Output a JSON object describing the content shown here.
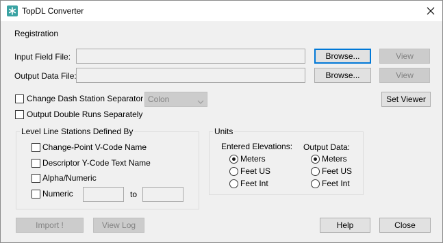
{
  "window": {
    "title": "TopDL Converter"
  },
  "registration": {
    "heading": "Registration",
    "input_field_label": "Input Field File:",
    "output_data_label": "Output Data File:",
    "input_field_value": "",
    "output_data_value": "",
    "browse_label": "Browse...",
    "view_label": "View"
  },
  "options": {
    "change_dash_label": "Change Dash Station Separator to:",
    "separator_value": "Colon",
    "output_double_runs_label": "Output Double Runs Separately",
    "set_viewer_label": "Set Viewer"
  },
  "level_line": {
    "title": "Level Line Stations Defined By",
    "change_point_label": "Change-Point V-Code Name",
    "descriptor_label": "Descriptor Y-Code Text Name",
    "alpha_numeric_label": "Alpha/Numeric",
    "numeric_label": "Numeric",
    "to_label": "to",
    "numeric_from": "",
    "numeric_to": ""
  },
  "units": {
    "title": "Units",
    "entered_elevations_label": "Entered Elevations:",
    "output_data_label": "Output Data:",
    "meters": "Meters",
    "feet_us": "Feet US",
    "feet_int": "Feet Int",
    "entered_selected": "Meters",
    "output_selected": "Meters"
  },
  "footer": {
    "import_label": "Import !",
    "view_log_label": "View Log",
    "help_label": "Help",
    "close_label": "Close"
  },
  "colors": {
    "accent": "#0078d7",
    "icon": "#3aa3a3"
  }
}
